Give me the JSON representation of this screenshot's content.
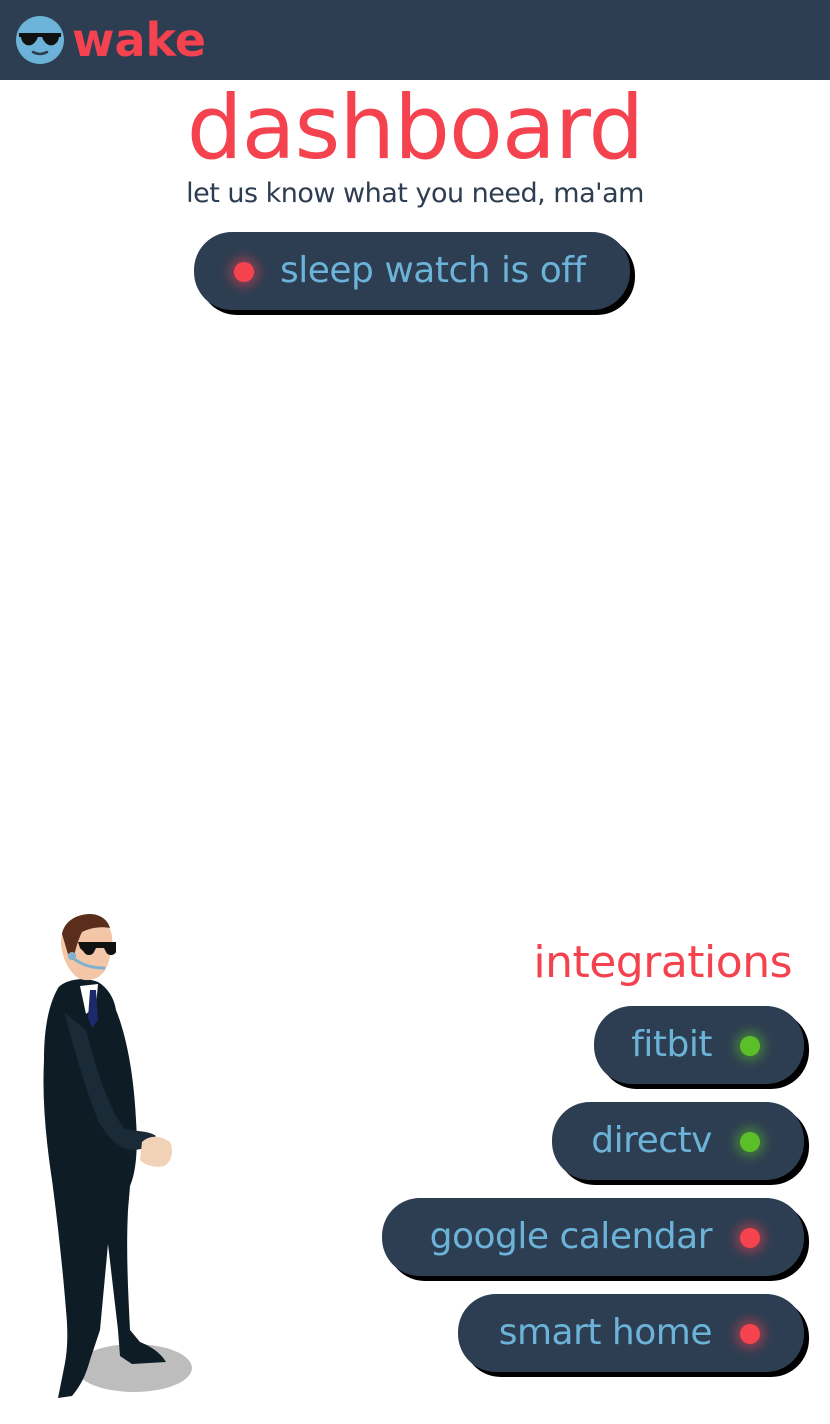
{
  "header": {
    "brand": "wake",
    "logo_icon": "sunglasses-face-icon"
  },
  "main": {
    "title": "dashboard",
    "subtitle": "let us know what you need, ma'am",
    "sleep_watch": {
      "label": "sleep watch is off",
      "status": "off",
      "status_color": "#f4424e"
    }
  },
  "integrations": {
    "title": "integrations",
    "items": [
      {
        "label": "fitbit",
        "status": "connected",
        "status_color": "#5cbf2a"
      },
      {
        "label": "directv",
        "status": "connected",
        "status_color": "#5cbf2a"
      },
      {
        "label": "google calendar",
        "status": "disconnected",
        "status_color": "#f4424e"
      },
      {
        "label": "smart home",
        "status": "disconnected",
        "status_color": "#f4424e"
      }
    ]
  },
  "illustration": {
    "name": "bodyguard-agent-illustration"
  },
  "colors": {
    "navbar": "#2e3e52",
    "accent": "#f4424e",
    "pill_text": "#6cb3d9",
    "pill_bg": "#2e3e52",
    "on": "#5cbf2a",
    "off": "#f4424e"
  }
}
